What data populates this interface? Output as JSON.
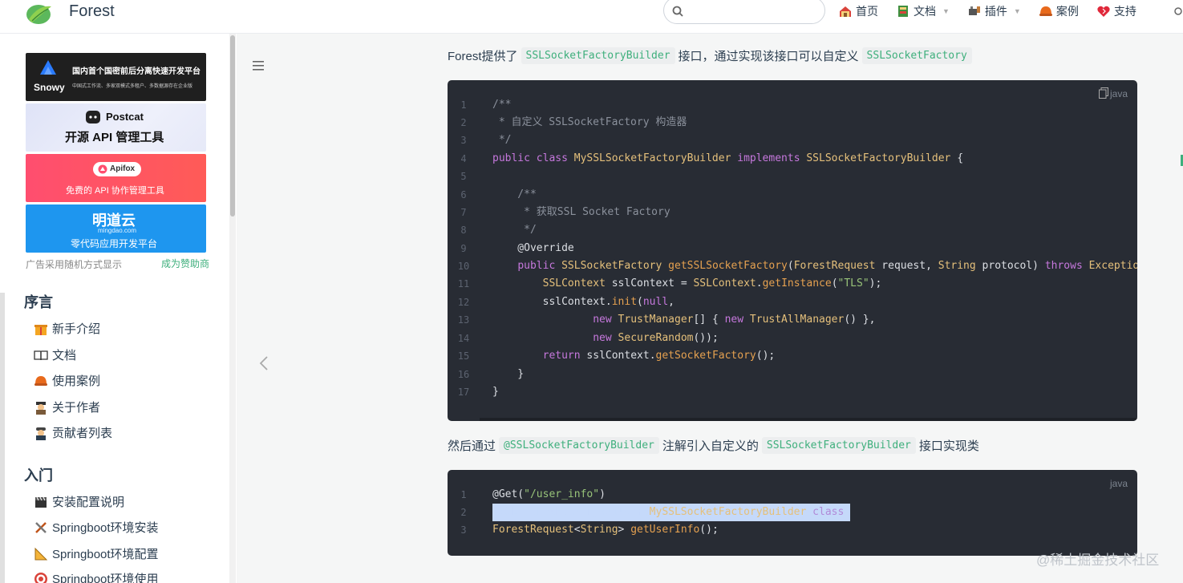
{
  "header": {
    "brand": "Forest",
    "search_placeholder": "",
    "nav": [
      {
        "label": "首页",
        "icon": "home-icon",
        "dropdown": false
      },
      {
        "label": "文档",
        "icon": "book-icon",
        "dropdown": true
      },
      {
        "label": "插件",
        "icon": "plugin-icon",
        "dropdown": true
      },
      {
        "label": "案例",
        "icon": "case-icon",
        "dropdown": false
      },
      {
        "label": "支持",
        "icon": "heart-icon",
        "dropdown": false
      }
    ]
  },
  "sidebar": {
    "ads": {
      "snowy_title": "国内首个国密前后分离快速开发平台",
      "snowy_brand": "Snowy",
      "snowy_sub": "中国式工作流、多家双模式多租户、多数据源存在企业版",
      "postcat_brand": "Postcat",
      "postcat_title": "开源 API 管理工具",
      "apifox_brand": "Apifox",
      "apifox_title": "免费的 API 协作管理工具",
      "mingdao_brand": "明道云",
      "mingdao_domain": "mingdao.com",
      "mingdao_title": "零代码应用开发平台"
    },
    "ad_note": "广告采用随机方式显示",
    "ad_sponsor": "成为赞助商",
    "sections": [
      {
        "title": "序言",
        "items": [
          {
            "label": "新手介绍",
            "icon": "gift-icon"
          },
          {
            "label": "文档",
            "icon": "book-open-icon"
          },
          {
            "label": "使用案例",
            "icon": "case-icon"
          },
          {
            "label": "关于作者",
            "icon": "detective-icon"
          },
          {
            "label": "贡献者列表",
            "icon": "worker-icon"
          }
        ]
      },
      {
        "title": "入门",
        "items": [
          {
            "label": "安装配置说明",
            "icon": "clapper-icon"
          },
          {
            "label": "Springboot环境安装",
            "icon": "tools-icon"
          },
          {
            "label": "Springboot环境配置",
            "icon": "triangle-ruler-icon"
          },
          {
            "label": "Springboot环境使用",
            "icon": "target-icon"
          }
        ]
      }
    ]
  },
  "content": {
    "para1": {
      "before": "Forest提供了",
      "code1": "SSLSocketFactoryBuilder",
      "middle": "接口，通过实现该接口可以自定义",
      "code2": "SSLSocketFactory"
    },
    "block1_lang": "java",
    "block1_lines": [
      "1",
      "2",
      "3",
      "4",
      "5",
      "6",
      "7",
      "8",
      "9",
      "10",
      "11",
      "12",
      "13",
      "14",
      "15",
      "16",
      "17"
    ],
    "para2": {
      "before": "然后通过",
      "code1": "@SSLSocketFactoryBuilder",
      "middle": "注解引入自定义的",
      "code2": "SSLSocketFactoryBuilder",
      "after": "接口实现类"
    },
    "block2_lang": "java",
    "block2_lines": [
      "1",
      "2",
      "3"
    ]
  },
  "watermark": "@稀土掘金技术社区"
}
